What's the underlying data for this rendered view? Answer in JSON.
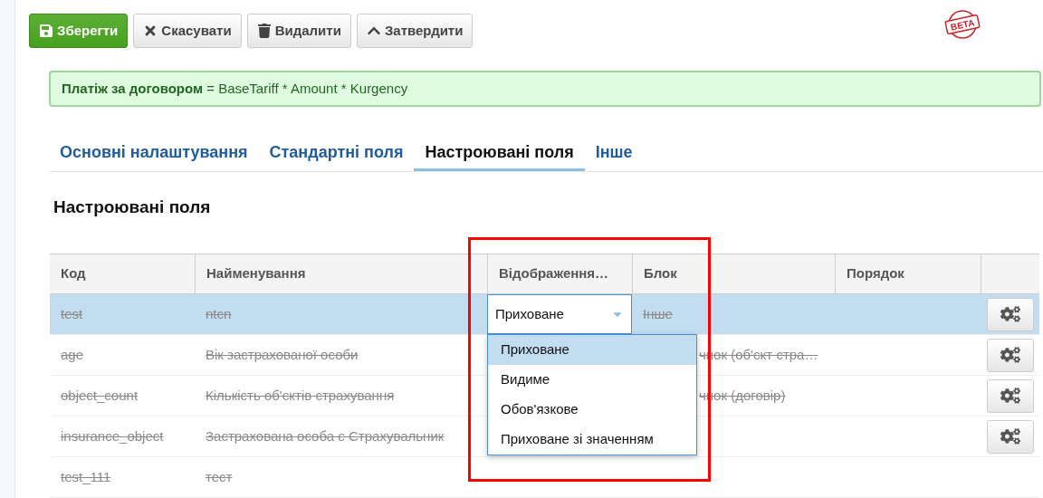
{
  "toolbar": [
    {
      "kind": "save",
      "label": "Зберегти"
    },
    {
      "kind": "cancel",
      "label": "Скасувати"
    },
    {
      "kind": "delete",
      "label": "Видалити"
    },
    {
      "kind": "approve",
      "label": "Затвердити"
    }
  ],
  "badge": {
    "label": "BETA"
  },
  "formula": {
    "name": "Платіж за договором",
    "expression": "= BaseTariff * Amount * Kurgency"
  },
  "tabs": [
    {
      "label": "Основні налаштування",
      "selected": false
    },
    {
      "label": "Стандартні поля",
      "selected": false
    },
    {
      "label": "Настроювані поля",
      "selected": true
    },
    {
      "label": "Інше",
      "selected": false
    }
  ],
  "section_title": "Настроювані поля",
  "table": {
    "columns": [
      "Код",
      "Найменування",
      "Відображення…",
      "Блок",
      "Порядок"
    ],
    "rows": [
      {
        "code": "test",
        "name": "ntcn",
        "display": "Приховане",
        "block": "Інше",
        "selected": true,
        "deleted": true,
        "actions": true
      },
      {
        "code": "age",
        "name": "Вік застрахованої особи",
        "block": "чнок (об'єкт стра…",
        "selected": false,
        "deleted": true,
        "actions": true
      },
      {
        "code": "object_count",
        "name": "Кількість об'єктів страхування",
        "block": "чнок (договір)",
        "selected": false,
        "deleted": true,
        "actions": true
      },
      {
        "code": "insurance_object",
        "name": "Застрахована особа є Страхувальник",
        "selected": false,
        "deleted": true,
        "actions": true
      },
      {
        "code": "test_111",
        "name": "тест",
        "selected": false,
        "deleted": true,
        "actions": false
      }
    ]
  },
  "dropdown": {
    "open": true,
    "options": [
      {
        "label": "Приховане",
        "selected": true
      },
      {
        "label": "Видиме",
        "selected": false
      },
      {
        "label": "Обов'язкове",
        "selected": false
      },
      {
        "label": "Приховане зі значенням",
        "selected": false
      }
    ]
  },
  "highlight": {
    "shown": true
  }
}
